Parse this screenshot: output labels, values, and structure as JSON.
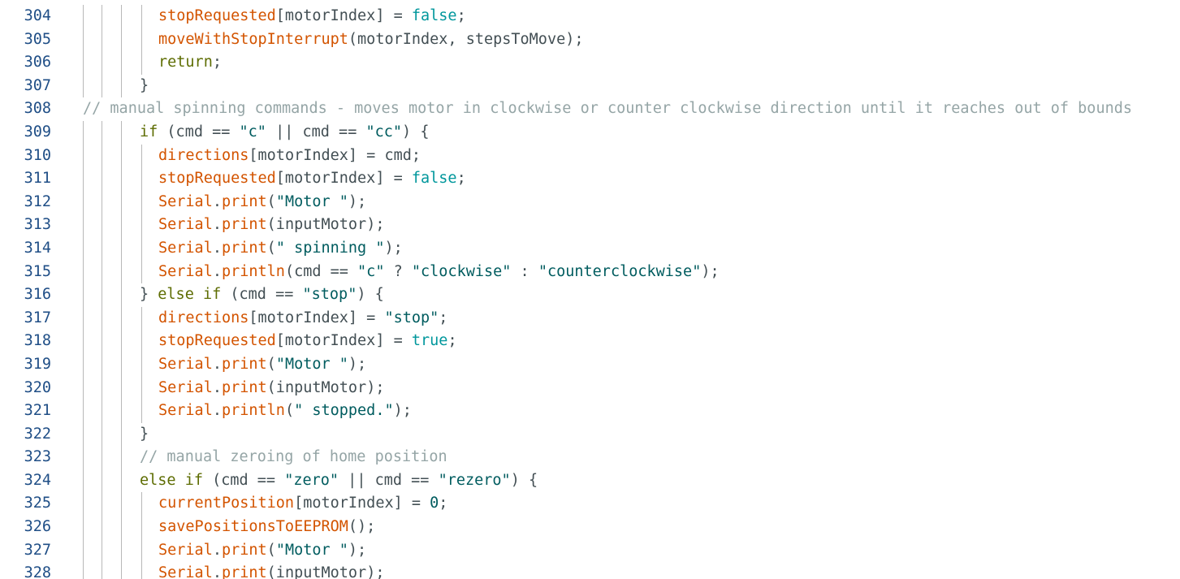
{
  "editor": {
    "colors": {
      "line_number": "#1f4e86",
      "variable": "#d35400",
      "keyword": "#5e6d03",
      "literal": "#00979c",
      "string": "#005c5f",
      "comment": "#95a5a6",
      "plain": "#434f54",
      "indent_guide": "#b8b8b8"
    },
    "lines": [
      {
        "number": "304",
        "indent": 4,
        "tokens": [
          [
            "var",
            "stopRequested"
          ],
          [
            "plain",
            "[motorIndex] = "
          ],
          [
            "lit",
            "false"
          ],
          [
            "plain",
            ";"
          ]
        ]
      },
      {
        "number": "305",
        "indent": 4,
        "tokens": [
          [
            "fn",
            "moveWithStopInterrupt"
          ],
          [
            "plain",
            "(motorIndex, stepsToMove);"
          ]
        ]
      },
      {
        "number": "306",
        "indent": 4,
        "tokens": [
          [
            "kw",
            "return"
          ],
          [
            "plain",
            ";"
          ]
        ]
      },
      {
        "number": "307",
        "indent": 3,
        "tokens": [
          [
            "plain",
            "}"
          ]
        ]
      },
      {
        "number": "308",
        "indent": 0,
        "tokens": [
          [
            "cmt",
            "// manual spinning commands - moves motor in clockwise or counter clockwise direction until it reaches out of bounds"
          ]
        ]
      },
      {
        "number": "309",
        "indent": 3,
        "tokens": [
          [
            "kw",
            "if"
          ],
          [
            "plain",
            " (cmd == "
          ],
          [
            "str",
            "\"c\""
          ],
          [
            "plain",
            " || cmd == "
          ],
          [
            "str",
            "\"cc\""
          ],
          [
            "plain",
            ") {"
          ]
        ]
      },
      {
        "number": "310",
        "indent": 4,
        "tokens": [
          [
            "var",
            "directions"
          ],
          [
            "plain",
            "[motorIndex] = cmd;"
          ]
        ]
      },
      {
        "number": "311",
        "indent": 4,
        "tokens": [
          [
            "var",
            "stopRequested"
          ],
          [
            "plain",
            "[motorIndex] = "
          ],
          [
            "lit",
            "false"
          ],
          [
            "plain",
            ";"
          ]
        ]
      },
      {
        "number": "312",
        "indent": 4,
        "tokens": [
          [
            "obj",
            "Serial"
          ],
          [
            "plain",
            "."
          ],
          [
            "fn",
            "print"
          ],
          [
            "plain",
            "("
          ],
          [
            "str",
            "\"Motor \""
          ],
          [
            "plain",
            ");"
          ]
        ]
      },
      {
        "number": "313",
        "indent": 4,
        "tokens": [
          [
            "obj",
            "Serial"
          ],
          [
            "plain",
            "."
          ],
          [
            "fn",
            "print"
          ],
          [
            "plain",
            "(inputMotor);"
          ]
        ]
      },
      {
        "number": "314",
        "indent": 4,
        "tokens": [
          [
            "obj",
            "Serial"
          ],
          [
            "plain",
            "."
          ],
          [
            "fn",
            "print"
          ],
          [
            "plain",
            "("
          ],
          [
            "str",
            "\" spinning \""
          ],
          [
            "plain",
            ");"
          ]
        ]
      },
      {
        "number": "315",
        "indent": 4,
        "tokens": [
          [
            "obj",
            "Serial"
          ],
          [
            "plain",
            "."
          ],
          [
            "fn",
            "println"
          ],
          [
            "plain",
            "(cmd == "
          ],
          [
            "str",
            "\"c\""
          ],
          [
            "plain",
            " ? "
          ],
          [
            "str",
            "\"clockwise\""
          ],
          [
            "plain",
            " : "
          ],
          [
            "str",
            "\"counterclockwise\""
          ],
          [
            "plain",
            ");"
          ]
        ]
      },
      {
        "number": "316",
        "indent": 3,
        "tokens": [
          [
            "plain",
            "} "
          ],
          [
            "kw",
            "else if"
          ],
          [
            "plain",
            " (cmd == "
          ],
          [
            "str",
            "\"stop\""
          ],
          [
            "plain",
            ") {"
          ]
        ]
      },
      {
        "number": "317",
        "indent": 4,
        "tokens": [
          [
            "var",
            "directions"
          ],
          [
            "plain",
            "[motorIndex] = "
          ],
          [
            "str",
            "\"stop\""
          ],
          [
            "plain",
            ";"
          ]
        ]
      },
      {
        "number": "318",
        "indent": 4,
        "tokens": [
          [
            "var",
            "stopRequested"
          ],
          [
            "plain",
            "[motorIndex] = "
          ],
          [
            "lit",
            "true"
          ],
          [
            "plain",
            ";"
          ]
        ]
      },
      {
        "number": "319",
        "indent": 4,
        "tokens": [
          [
            "obj",
            "Serial"
          ],
          [
            "plain",
            "."
          ],
          [
            "fn",
            "print"
          ],
          [
            "plain",
            "("
          ],
          [
            "str",
            "\"Motor \""
          ],
          [
            "plain",
            ");"
          ]
        ]
      },
      {
        "number": "320",
        "indent": 4,
        "tokens": [
          [
            "obj",
            "Serial"
          ],
          [
            "plain",
            "."
          ],
          [
            "fn",
            "print"
          ],
          [
            "plain",
            "(inputMotor);"
          ]
        ]
      },
      {
        "number": "321",
        "indent": 4,
        "tokens": [
          [
            "obj",
            "Serial"
          ],
          [
            "plain",
            "."
          ],
          [
            "fn",
            "println"
          ],
          [
            "plain",
            "("
          ],
          [
            "str",
            "\" stopped.\""
          ],
          [
            "plain",
            ");"
          ]
        ]
      },
      {
        "number": "322",
        "indent": 3,
        "tokens": [
          [
            "plain",
            "}"
          ]
        ]
      },
      {
        "number": "323",
        "indent": 3,
        "tokens": [
          [
            "cmt",
            "// manual zeroing of home position"
          ]
        ]
      },
      {
        "number": "324",
        "indent": 3,
        "tokens": [
          [
            "kw",
            "else if"
          ],
          [
            "plain",
            " (cmd == "
          ],
          [
            "str",
            "\"zero\""
          ],
          [
            "plain",
            " || cmd == "
          ],
          [
            "str",
            "\"rezero\""
          ],
          [
            "plain",
            ") {"
          ]
        ]
      },
      {
        "number": "325",
        "indent": 4,
        "tokens": [
          [
            "var",
            "currentPosition"
          ],
          [
            "plain",
            "[motorIndex] = "
          ],
          [
            "num",
            "0"
          ],
          [
            "plain",
            ";"
          ]
        ]
      },
      {
        "number": "326",
        "indent": 4,
        "tokens": [
          [
            "fn",
            "savePositionsToEEPROM"
          ],
          [
            "plain",
            "();"
          ]
        ]
      },
      {
        "number": "327",
        "indent": 4,
        "tokens": [
          [
            "obj",
            "Serial"
          ],
          [
            "plain",
            "."
          ],
          [
            "fn",
            "print"
          ],
          [
            "plain",
            "("
          ],
          [
            "str",
            "\"Motor \""
          ],
          [
            "plain",
            ");"
          ]
        ]
      },
      {
        "number": "328",
        "indent": 4,
        "tokens": [
          [
            "obj",
            "Serial"
          ],
          [
            "plain",
            "."
          ],
          [
            "fn",
            "print"
          ],
          [
            "plain",
            "(inputMotor);"
          ]
        ]
      }
    ]
  }
}
